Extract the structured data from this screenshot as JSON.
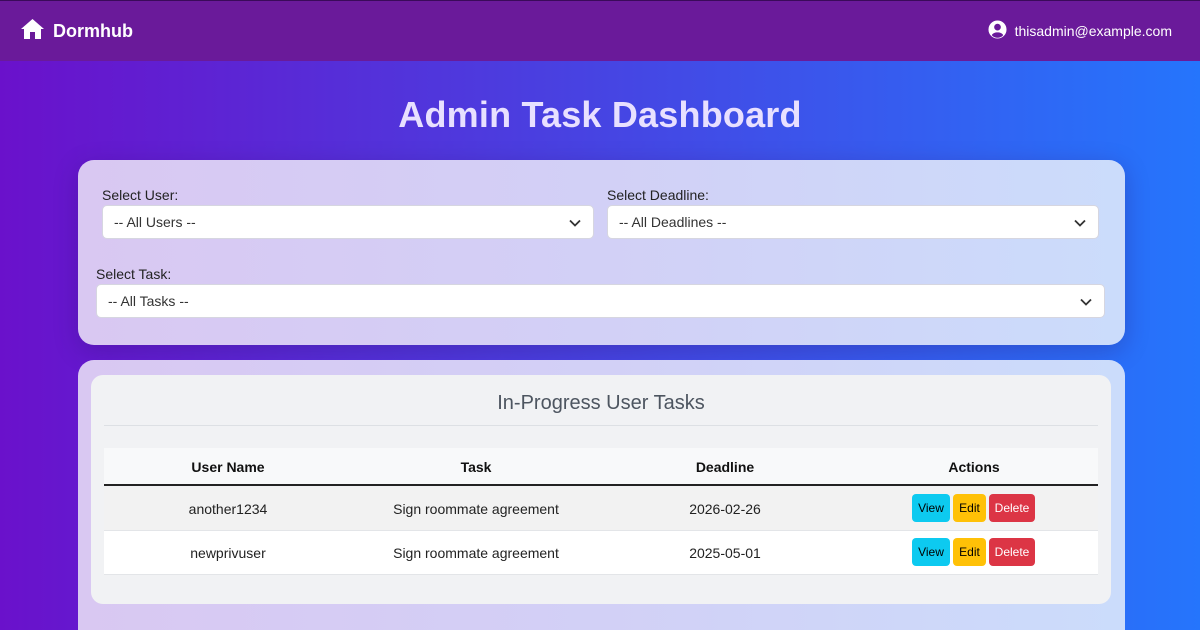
{
  "navbar": {
    "brand": "Dormhub",
    "user_email": "thisadmin@example.com"
  },
  "page": {
    "title": "Admin Task Dashboard"
  },
  "filters": {
    "user": {
      "label": "Select User:",
      "value": "-- All Users --"
    },
    "deadline": {
      "label": "Select Deadline:",
      "value": "-- All Deadlines --"
    },
    "task": {
      "label": "Select Task:",
      "value": "-- All Tasks --"
    }
  },
  "table": {
    "title": "In-Progress User Tasks",
    "headers": {
      "user": "User Name",
      "task": "Task",
      "deadline": "Deadline",
      "actions": "Actions"
    },
    "rows": [
      {
        "user": "another1234",
        "task": "Sign roommate agreement",
        "deadline": "2026-02-26"
      },
      {
        "user": "newprivuser",
        "task": "Sign roommate agreement",
        "deadline": "2025-05-01"
      }
    ],
    "actions": {
      "view": "View",
      "edit": "Edit",
      "delete": "Delete"
    }
  },
  "colors": {
    "view": "#0dcaf0",
    "edit": "#ffc107",
    "delete": "#dc3545",
    "navbar": "#6a1a9a"
  },
  "icons": {
    "brand": "home-icon",
    "user": "user-circle-icon",
    "dropdown": "chevron-down-icon"
  }
}
